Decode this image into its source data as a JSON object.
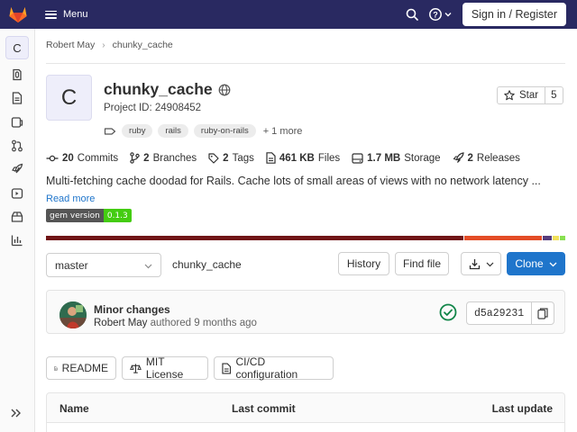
{
  "topbar": {
    "menu_label": "Menu",
    "signin_label": "Sign in / Register"
  },
  "sidebar": {
    "project_initial": "C",
    "items": [
      "project-overview-icon",
      "repository-icon",
      "issues-icon",
      "merge-requests-icon",
      "deployments-icon",
      "monitor-icon",
      "packages-icon",
      "analytics-icon"
    ]
  },
  "breadcrumb": {
    "owner": "Robert May",
    "project": "chunky_cache"
  },
  "project": {
    "initial": "C",
    "name": "chunky_cache",
    "id_text": "Project ID: 24908452",
    "star_label": "Star",
    "star_count": "5",
    "topics": [
      "ruby",
      "rails",
      "ruby-on-rails"
    ],
    "more_topics": "+ 1 more"
  },
  "stats": {
    "commits_count": "20",
    "commits_label": "Commits",
    "branches_count": "2",
    "branches_label": "Branches",
    "tags_count": "2",
    "tags_label": "Tags",
    "files_size": "461 KB",
    "files_label": "Files",
    "storage_size": "1.7 MB",
    "storage_label": "Storage",
    "releases_count": "2",
    "releases_label": "Releases"
  },
  "description": {
    "text": "Multi-fetching cache doodad for Rails. Cache lots of small areas of views with no network latency ...",
    "read_more": "Read more"
  },
  "badge": {
    "label": "gem version",
    "value": "0.1.3"
  },
  "language_bar": [
    {
      "share": 0.81,
      "color": "#701516"
    },
    {
      "share": 0.15,
      "color": "#e34c26"
    },
    {
      "share": 0.017,
      "color": "#563d7c"
    },
    {
      "share": 0.012,
      "color": "#f1e05a"
    },
    {
      "share": 0.011,
      "color": "#89e051"
    }
  ],
  "branch_row": {
    "branch": "master",
    "path": "chunky_cache",
    "history_label": "History",
    "find_file_label": "Find file",
    "clone_label": "Clone"
  },
  "commit": {
    "title": "Minor changes",
    "author": "Robert May",
    "meta_suffix": "authored 9 months ago",
    "sha": "d5a29231"
  },
  "docs": {
    "readme_label": "README",
    "license_label": "MIT License",
    "cicd_label": "CI/CD configuration"
  },
  "table": {
    "col_name": "Name",
    "col_last_commit": "Last commit",
    "col_last_update": "Last update"
  },
  "colors": {
    "navbar": "#292961",
    "primary": "#1f75cb",
    "success": "#108548"
  }
}
